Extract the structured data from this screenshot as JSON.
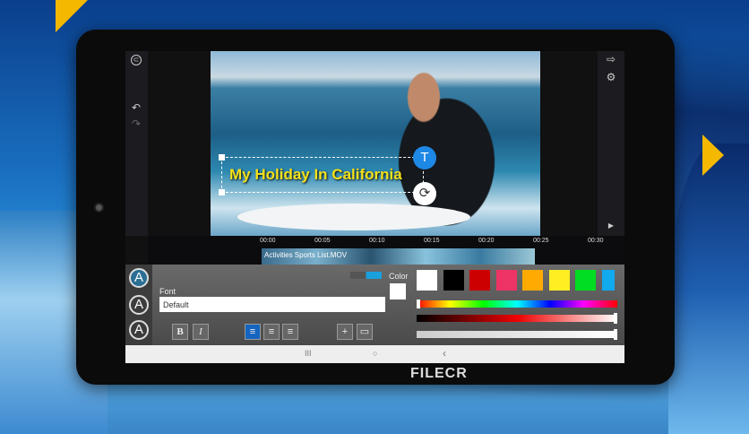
{
  "app": {
    "title_text": "My Holiday In California",
    "clip_name": "Activities Sports List.MOV"
  },
  "timeline": {
    "ticks": [
      "00:00",
      "00:05",
      "00:10",
      "00:15",
      "00:20",
      "00:25",
      "00:30"
    ]
  },
  "panel": {
    "font_label": "Font",
    "font_value": "Default",
    "color_label": "Color",
    "bold": "B",
    "italic": "I",
    "style_glyph": "A"
  },
  "swatches": [
    "#ffffff",
    "#000000",
    "#cc0000",
    "#ee3366",
    "#ffaa00",
    "#ffee22",
    "#00dd22",
    "#11aaee"
  ],
  "nav": {
    "recent": "III",
    "home": "○",
    "back": "‹"
  },
  "watermark": "FILECR",
  "icons": {
    "back": "⊂",
    "undo": "↶",
    "redo": "↷",
    "export": "⇨",
    "settings": "⚙",
    "play": "▶",
    "text_tool": "T",
    "rotate": "⟳"
  }
}
